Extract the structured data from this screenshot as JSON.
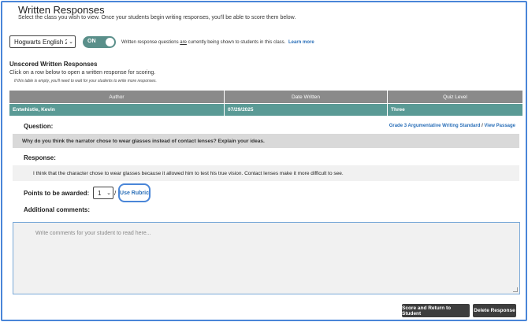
{
  "header": {
    "title": "Written Responses",
    "intro": "Select the class you wish to view. Once your students begin writing responses, you'll be able to score them below."
  },
  "class_select": {
    "value": "Hogwarts English 2("
  },
  "toggle": {
    "label": "ON",
    "note_before": "Written response questions ",
    "note_emphasis": "are",
    "note_after": " currently being shown to students in this class.",
    "learn_more": "Learn more"
  },
  "unscored": {
    "title": "Unscored Written Responses",
    "subtitle": "Click on a row below to open a written response for scoring.",
    "hint": "If this table is empty, you'll need to wait for your students to write more responses.",
    "columns": [
      "Author",
      "Date Written",
      "Quiz Level"
    ],
    "rows": [
      {
        "author": "Entwhistle, Kevin",
        "date": "07/29/2025",
        "level": "Three"
      }
    ]
  },
  "detail": {
    "question_label": "Question:",
    "standard_link": "Grade 3 Argumentative Writing Standard",
    "link_separator": "/",
    "passage_link": "View Passage",
    "question_text": "Why do you think the narrator chose to wear glasses instead of contact lenses? Explain your ideas.",
    "response_label": "Response:",
    "response_text": "I think that the character chose to wear glasses because it allowed him to test his true vision. Contact lenses make it more difficult to see.",
    "points_label": "Points to be awarded:",
    "points_value": "1",
    "points_slash": "/",
    "rubric_link": "Use Rubric",
    "comments_label": "Additional comments:",
    "comments_placeholder": "Write comments for your student to read here..."
  },
  "actions": {
    "score_button": "Score and Return to Student",
    "delete_button": "Delete Response"
  },
  "colors": {
    "accent_blue": "#4a86d8",
    "row_teal": "#5a9a95",
    "toggle_green": "#5a8f8a",
    "header_gray": "#8a8a8a",
    "button_dark": "#3d3d3d"
  }
}
